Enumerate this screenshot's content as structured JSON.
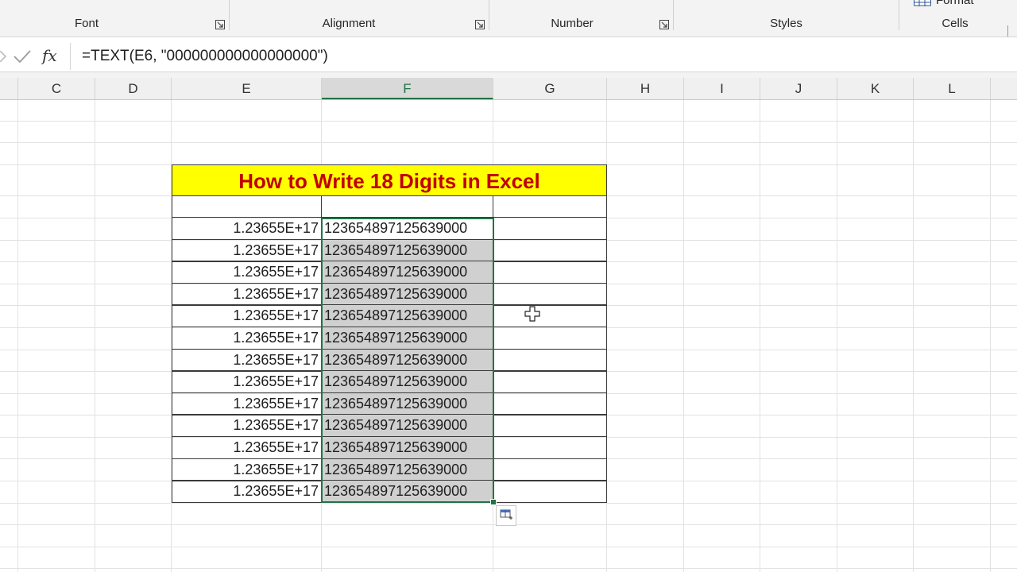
{
  "ribbon": {
    "groups": [
      {
        "label": "Font"
      },
      {
        "label": "Alignment"
      },
      {
        "label": "Number"
      },
      {
        "label": "Styles"
      },
      {
        "label": "Cells"
      }
    ],
    "partial_text_cells": "Format"
  },
  "formula_bar": {
    "formula": "=TEXT(E6, \"000000000000000000\")"
  },
  "columns": [
    "C",
    "D",
    "E",
    "F",
    "G",
    "H",
    "I",
    "J",
    "K",
    "L"
  ],
  "selected_column": "F",
  "sheet": {
    "title": "How to Write 18 Digits in Excel",
    "rows": [
      {
        "e": "1.23655E+17",
        "f": "123654897125639000"
      },
      {
        "e": "1.23655E+17",
        "f": "123654897125639000"
      },
      {
        "e": "1.23655E+17",
        "f": "123654897125639000"
      },
      {
        "e": "1.23655E+17",
        "f": "123654897125639000"
      },
      {
        "e": "1.23655E+17",
        "f": "123654897125639000"
      },
      {
        "e": "1.23655E+17",
        "f": "123654897125639000"
      },
      {
        "e": "1.23655E+17",
        "f": "123654897125639000"
      },
      {
        "e": "1.23655E+17",
        "f": "123654897125639000"
      },
      {
        "e": "1.23655E+17",
        "f": "123654897125639000"
      },
      {
        "e": "1.23655E+17",
        "f": "123654897125639000"
      },
      {
        "e": "1.23655E+17",
        "f": "123654897125639000"
      },
      {
        "e": "1.23655E+17",
        "f": "123654897125639000"
      },
      {
        "e": "1.23655E+17",
        "f": "123654897125639000"
      }
    ]
  },
  "colors": {
    "title_bg": "#ffff00",
    "title_text": "#c00000",
    "selection": "#217346"
  }
}
